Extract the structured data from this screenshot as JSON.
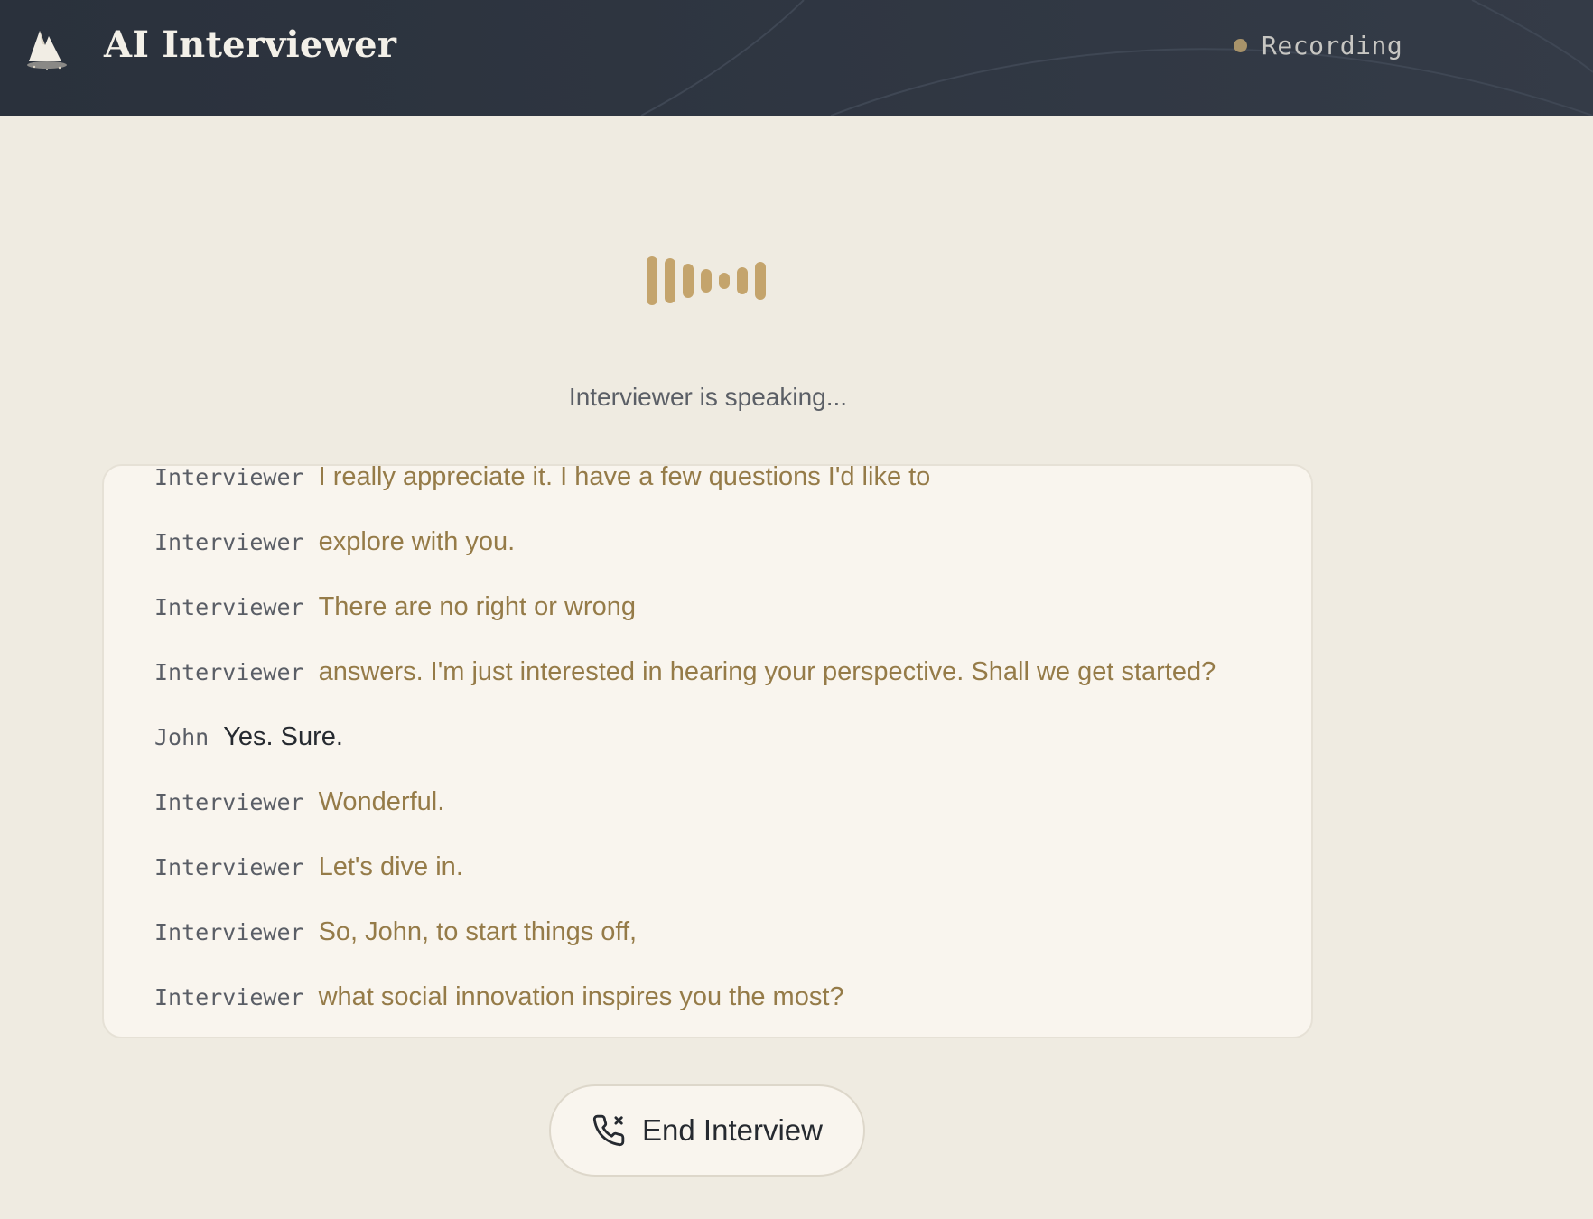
{
  "header": {
    "title": "AI Interviewer",
    "logo_icon": "mountain-logo-icon",
    "recording": {
      "label": "Recording",
      "dot_color": "#a8936a"
    }
  },
  "voice": {
    "waveform_icon": "audio-waveform-icon",
    "status": "Interviewer is speaking..."
  },
  "transcript": [
    {
      "speaker": "Interviewer",
      "text": "I really appreciate it. I have a few questions I'd like to",
      "role": "interviewer"
    },
    {
      "speaker": "Interviewer",
      "text": "explore with you.",
      "role": "interviewer"
    },
    {
      "speaker": "Interviewer",
      "text": "There are no right or wrong",
      "role": "interviewer"
    },
    {
      "speaker": "Interviewer",
      "text": "answers. I'm just interested in hearing your perspective. Shall we get started?",
      "role": "interviewer"
    },
    {
      "speaker": "John",
      "text": "Yes. Sure.",
      "role": "user"
    },
    {
      "speaker": "Interviewer",
      "text": "Wonderful.",
      "role": "interviewer"
    },
    {
      "speaker": "Interviewer",
      "text": "Let's dive in.",
      "role": "interviewer"
    },
    {
      "speaker": "Interviewer",
      "text": "So, John, to start things off,",
      "role": "interviewer"
    },
    {
      "speaker": "Interviewer",
      "text": "what social innovation inspires you the most?",
      "role": "interviewer"
    }
  ],
  "colors": {
    "interviewer_text": "#957b48",
    "user_text": "#262a30",
    "accent": "#c4a46c",
    "background": "#efebe1",
    "header_bg": "#2d343f"
  },
  "actions": {
    "end_label": "End Interview",
    "end_icon": "phone-end-icon"
  }
}
